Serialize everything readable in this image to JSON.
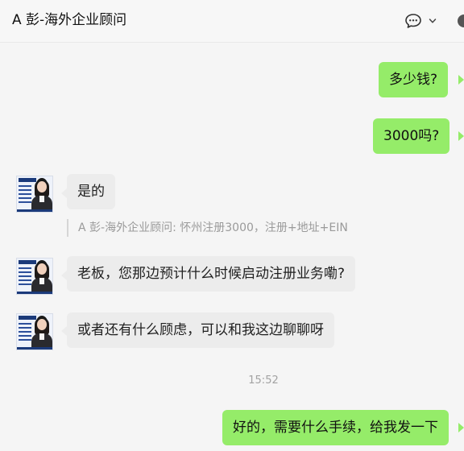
{
  "header": {
    "title": "A 彭-海外企业顾问",
    "chat_icon": "chat-bubble-dots-icon",
    "chevron_icon": "chevron-down-icon"
  },
  "messages": [
    {
      "sender": "me",
      "text": "多少钱?"
    },
    {
      "sender": "me",
      "text": "3000吗?"
    },
    {
      "sender": "them",
      "text": "是的"
    },
    {
      "type": "quote",
      "author": "A 彭-海外企业顾问",
      "text": "怀州注册3000，注册+地址+EIN"
    },
    {
      "sender": "them",
      "text": "老板，您那边预计什么时候启动注册业务嘞?"
    },
    {
      "sender": "them",
      "text": "或者还有什么顾虑，可以和我这边聊聊呀"
    },
    {
      "type": "timestamp",
      "text": "15:52"
    },
    {
      "sender": "me",
      "text": "好的，需要什么手续，给我发一下"
    }
  ],
  "colors": {
    "my_bubble": "#95ec69",
    "their_bubble": "#ececec",
    "background": "#f5f5f5"
  }
}
